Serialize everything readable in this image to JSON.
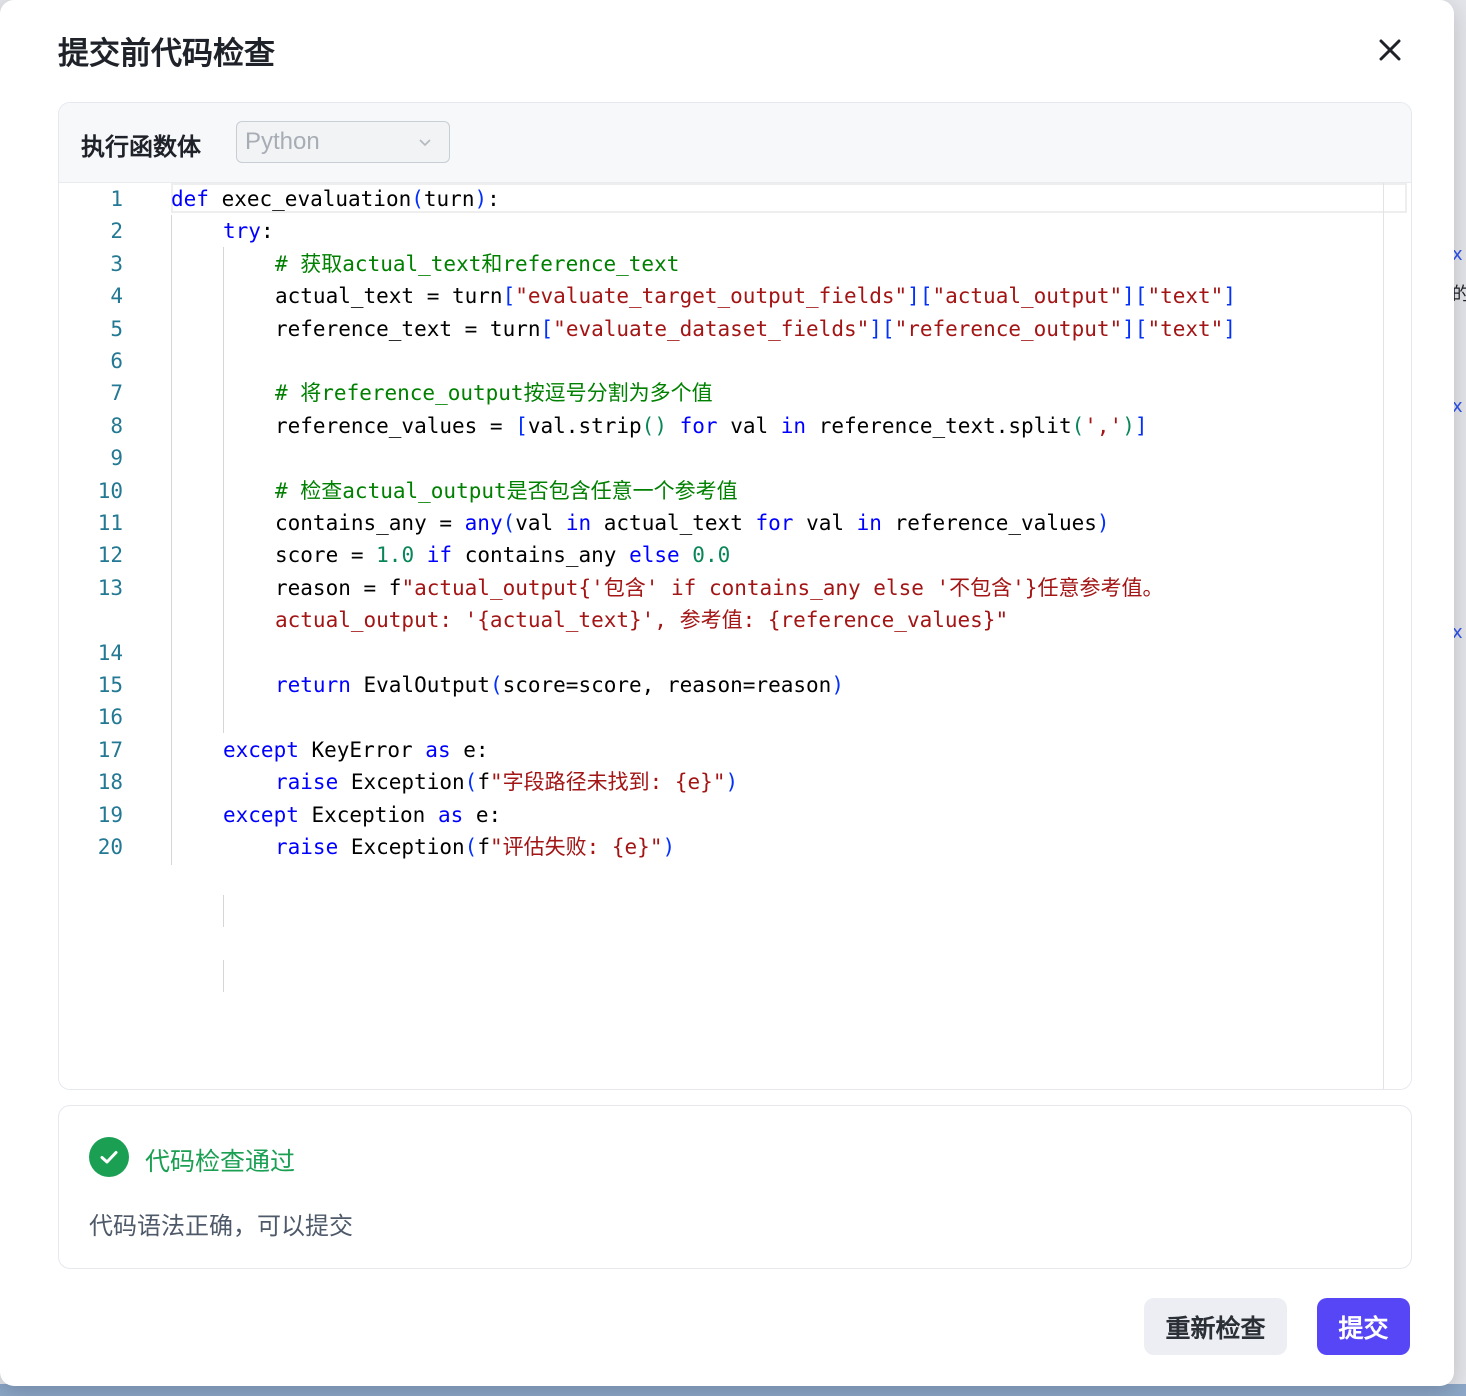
{
  "dialog": {
    "title": "提交前代码检查",
    "close_icon": "close-icon"
  },
  "editor": {
    "label": "执行函数体",
    "language": "Python",
    "line_numbers": [
      "1",
      "2",
      "3",
      "4",
      "5",
      "6",
      "7",
      "8",
      "9",
      "10",
      "11",
      "12",
      "13",
      "14",
      "15",
      "16",
      "17",
      "18",
      "19",
      "20"
    ],
    "code": {
      "l1_def": "def",
      "l1_name": " exec_evaluation",
      "l1_paren_open": "(",
      "l1_arg": "turn",
      "l1_paren_close": ")",
      "l1_colon": ":",
      "l2_try": "try",
      "l2_colon": ":",
      "l3_comment": "# 获取actual_text和reference_text",
      "l4_lhs": "actual_text = turn",
      "l4_b1o": "[",
      "l4_s1": "\"evaluate_target_output_fields\"",
      "l4_b1c": "]",
      "l4_b2o": "[",
      "l4_s2": "\"actual_output\"",
      "l4_b2c": "]",
      "l4_b3o": "[",
      "l4_s3": "\"text\"",
      "l4_b3c": "]",
      "l5_lhs": "reference_text = turn",
      "l5_b1o": "[",
      "l5_s1": "\"evaluate_dataset_fields\"",
      "l5_b1c": "]",
      "l5_b2o": "[",
      "l5_s2": "\"reference_output\"",
      "l5_b2c": "]",
      "l5_b3o": "[",
      "l5_s3": "\"text\"",
      "l5_b3c": "]",
      "l7_comment": "# 将reference_output按逗号分割为多个值",
      "l8_a": "reference_values = ",
      "l8_bo": "[",
      "l8_b": "val.strip",
      "l8_po": "()",
      "l8_for": "for",
      "l8_c": " val ",
      "l8_in": "in",
      "l8_d": " reference_text.split",
      "l8_p2o": "(",
      "l8_str": "','",
      "l8_p2c": ")",
      "l8_bc": "]",
      "l10_comment": "# 检查actual_output是否包含任意一个参考值",
      "l11_a": "contains_any = ",
      "l11_any": "any",
      "l11_po": "(",
      "l11_b": "val ",
      "l11_in1": "in",
      "l11_c": " actual_text ",
      "l11_for": "for",
      "l11_d": " val ",
      "l11_in2": "in",
      "l11_e": " reference_values",
      "l11_pc": ")",
      "l12_a": "score = ",
      "l12_n1": "1.0",
      "l12_if": "if",
      "l12_b": " contains_any ",
      "l12_else": "else",
      "l12_n2": "0.0",
      "l13_a": "reason = f",
      "l13_str": "\"actual_output{'包含' if contains_any else '不包含'}任意参考值。",
      "l13b_str": "actual_output: '{actual_text}', 参考值: {reference_values}\"",
      "l15_return": "return",
      "l15_a": " EvalOutput",
      "l15_po": "(",
      "l15_b": "score=score, reason=reason",
      "l15_pc": ")",
      "l17_except": "except",
      "l17_a": " KeyError ",
      "l17_as": "as",
      "l17_b": " e:",
      "l18_raise": "raise",
      "l18_a": " Exception",
      "l18_po": "(",
      "l18_f": "f",
      "l18_str": "\"字段路径未找到: {e}\"",
      "l18_pc": ")",
      "l19_except": "except",
      "l19_a": " Exception ",
      "l19_as": "as",
      "l19_b": " e:",
      "l20_raise": "raise",
      "l20_a": " Exception",
      "l20_po": "(",
      "l20_f": "f",
      "l20_str": "\"评估失败: {e}\"",
      "l20_pc": ")"
    }
  },
  "result": {
    "status_icon": "check-circle-icon",
    "title": "代码检查通过",
    "message": "代码语法正确，可以提交"
  },
  "footer": {
    "recheck_label": "重新检查",
    "submit_label": "提交"
  },
  "background": {
    "edge_glyphs": [
      "x",
      "的",
      "x",
      "x"
    ]
  },
  "colors": {
    "accent": "#5746f5",
    "success": "#1a9f53",
    "keyword": "#0000ff",
    "string": "#a31515",
    "comment": "#008000",
    "number": "#098658",
    "line_number": "#237893"
  }
}
